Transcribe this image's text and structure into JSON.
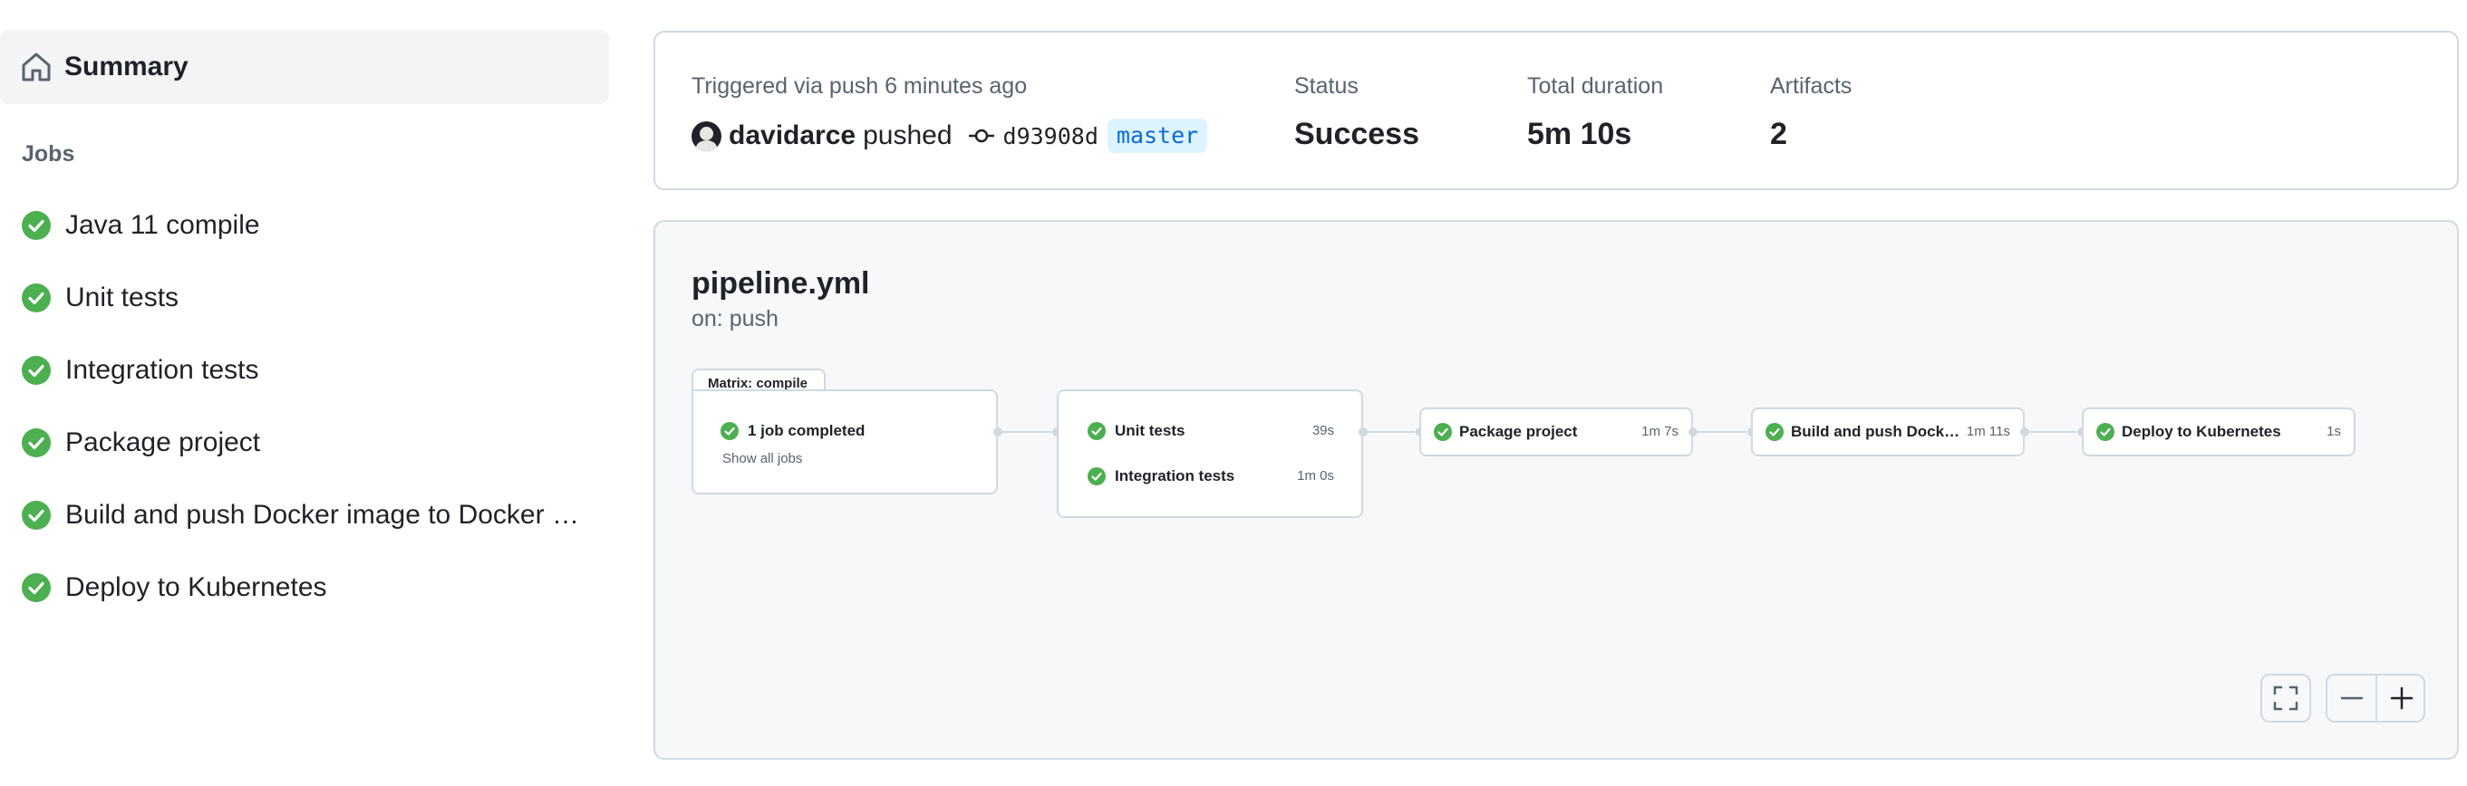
{
  "sidebar": {
    "summary_label": "Summary",
    "jobs_heading": "Jobs",
    "jobs": [
      {
        "label": "Java 11 compile",
        "status": "success"
      },
      {
        "label": "Unit tests",
        "status": "success"
      },
      {
        "label": "Integration tests",
        "status": "success"
      },
      {
        "label": "Package project",
        "status": "success"
      },
      {
        "label": "Build and push Docker image to Docker H...",
        "status": "success"
      },
      {
        "label": "Deploy to Kubernetes",
        "status": "success"
      }
    ]
  },
  "run": {
    "trigger_text": "Triggered via push 6 minutes ago",
    "username": "davidarce",
    "action": "pushed",
    "commit_sha": "d93908d",
    "branch": "master",
    "status_label": "Status",
    "status_value": "Success",
    "duration_label": "Total duration",
    "duration_value": "5m 10s",
    "artifacts_label": "Artifacts",
    "artifacts_value": "2"
  },
  "workflow": {
    "name": "pipeline.yml",
    "trigger": "on: push",
    "matrix_label": "Matrix: compile",
    "matrix_summary": "1 job completed",
    "matrix_link": "Show all jobs",
    "test_jobs": [
      {
        "label": "Unit tests",
        "time": "39s"
      },
      {
        "label": "Integration tests",
        "time": "1m 0s"
      }
    ],
    "package_job": {
      "label": "Package project",
      "time": "1m 7s"
    },
    "docker_job": {
      "label": "Build and push Docker i...",
      "time": "1m 11s"
    },
    "deploy_job": {
      "label": "Deploy to Kubernetes",
      "time": "1s"
    }
  },
  "colors": {
    "success": "#1a7f37",
    "success_light": "#4caf50",
    "border": "#d1d9e0",
    "muted_text": "#59636e",
    "branch_bg": "#ddf4ff",
    "branch_text": "#0969da"
  },
  "icons": {
    "summary": "home-icon",
    "job_status": "check-circle-icon",
    "commit": "git-commit-icon",
    "fullscreen": "fullscreen-icon",
    "zoom_out": "minus-icon",
    "zoom_in": "plus-icon"
  }
}
